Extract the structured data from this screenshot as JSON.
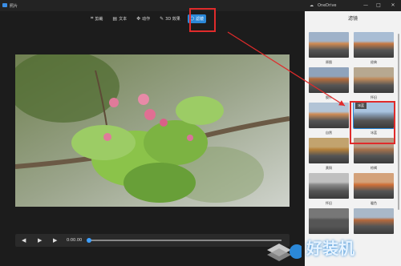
{
  "app": {
    "title": "照片"
  },
  "onedrive": {
    "title": "OneDrive"
  },
  "window_controls": [
    "—",
    "□",
    "✕"
  ],
  "toolbar": {
    "items": [
      {
        "label": "剪裁",
        "icon": "crop-icon"
      },
      {
        "label": "文本",
        "icon": "text-icon"
      },
      {
        "label": "动作",
        "icon": "motion-icon"
      },
      {
        "label": "3D 效果",
        "icon": "effects-icon"
      },
      {
        "label": "滤镜",
        "icon": "filter-icon",
        "active": true
      }
    ]
  },
  "player": {
    "time": "0:00.00"
  },
  "filters_panel": {
    "title": "滤镜",
    "tooltip": "冰蓝",
    "items": [
      {
        "label": "原图",
        "tint": "#d08a52",
        "sky": "#9fb2c9"
      },
      {
        "label": "经典",
        "tint": "#c87a44",
        "sky": "#a9bdd4"
      },
      {
        "label": "胶片",
        "tint": "#b66b3a",
        "sky": "#8fa3bc"
      },
      {
        "label": "怀旧",
        "tint": "#c08a5a",
        "sky": "#b7a890"
      },
      {
        "label": "自然",
        "tint": "#cf8c56",
        "sky": "#b2c4d6"
      },
      {
        "label": "冰蓝",
        "tint": "#8aa0b8",
        "sky": "#aac4e0",
        "selected": true
      },
      {
        "label": "黄铜",
        "tint": "#b5813a",
        "sky": "#c2a36e"
      },
      {
        "label": "棕褐",
        "tint": "#a7714a",
        "sky": "#b59c86"
      },
      {
        "label": "怀旧",
        "tint": "#8a8a8a",
        "sky": "#c0c0c0"
      },
      {
        "label": "暖色",
        "tint": "#d07038",
        "sky": "#d4a27a"
      },
      {
        "label": "",
        "tint": "#555555",
        "sky": "#777777"
      },
      {
        "label": "",
        "tint": "#b86a3c",
        "sky": "#a9b8c8"
      }
    ]
  },
  "watermark": {
    "text": "好装机"
  },
  "colors": {
    "accent": "#2b88d8",
    "highlight": "#e02b2b"
  }
}
